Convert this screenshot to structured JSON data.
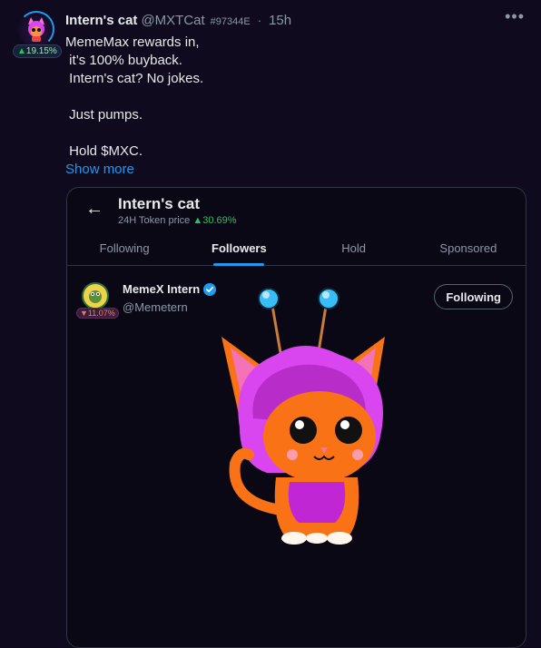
{
  "post": {
    "author_name": "Intern's cat",
    "handle": "@MXTCat",
    "hash": "#97344E",
    "separator": "·",
    "time": "15h",
    "more_icon": "more-horizontal-icon",
    "price_badge": {
      "arrow": "▲",
      "value": "19.15%"
    },
    "body": "MemeMax rewards in,\n it’s 100% buyback.\n Intern's cat? No jokes.\n\n Just pumps.\n\n Hold $MXC.",
    "show_more": "Show more"
  },
  "card": {
    "title": "Intern's cat",
    "subtitle_label": "24H Token price",
    "subtitle_arrow": "▲",
    "subtitle_value": "30.69%",
    "tabs": [
      {
        "label": "Following",
        "active": false
      },
      {
        "label": "Followers",
        "active": true
      },
      {
        "label": "Hold",
        "active": false
      },
      {
        "label": "Sponsored",
        "active": false
      }
    ],
    "user": {
      "name": "MemeX Intern",
      "handle": "@Memetern",
      "badge_arrow": "▼",
      "badge_value": "11.07%",
      "button_label": "Following"
    }
  },
  "colors": {
    "accent": "#1d9bf0",
    "positive": "#22c55e",
    "negative": "#f87171",
    "background": "#0f0a1e"
  }
}
